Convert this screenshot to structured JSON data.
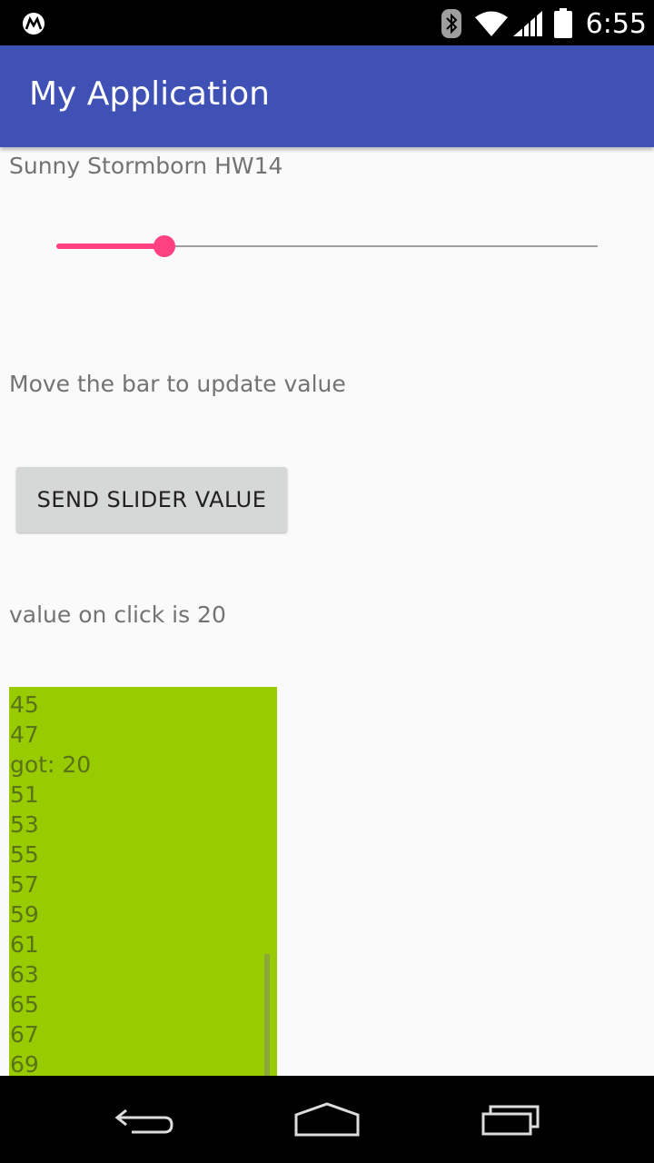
{
  "status_bar": {
    "time": "6:55",
    "icons": [
      "motorola-logo-icon",
      "bluetooth-icon",
      "wifi-icon",
      "signal-icon",
      "battery-icon"
    ]
  },
  "app_bar": {
    "title": "My Application",
    "color": "#3f51b5"
  },
  "main": {
    "header_text": "Sunny Stormborn HW14",
    "slider": {
      "value": 20,
      "max": 100,
      "accent_color": "#ff4081"
    },
    "hint_text": "Move the bar to update value",
    "send_button_label": "SEND SLIDER VALUE",
    "value_text": "value on click is 20",
    "log": {
      "background_color": "#99cc00",
      "lines": [
        "45",
        "47",
        "got: 20",
        "51",
        "53",
        "55",
        "57",
        "59",
        "61",
        "63",
        "65",
        "67",
        "69"
      ]
    }
  },
  "nav_bar": {
    "icons": [
      "back-icon",
      "home-icon",
      "recents-icon"
    ]
  }
}
